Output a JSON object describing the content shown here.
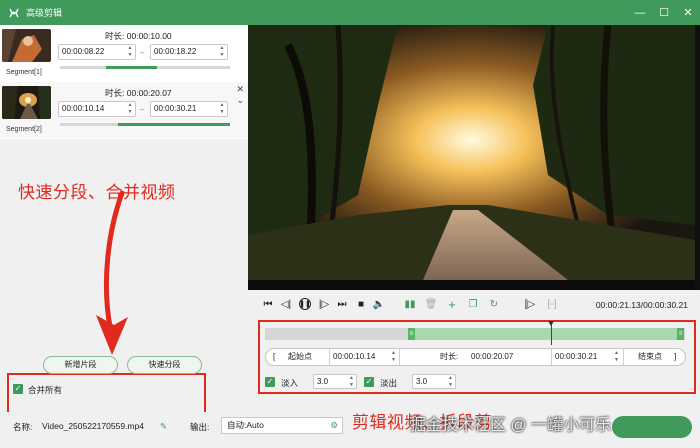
{
  "window": {
    "title": "高级剪辑",
    "controls": {
      "minimize": "—",
      "maximize": "☐",
      "close": "✕"
    }
  },
  "segments": [
    {
      "label": "Segment[1]",
      "duration_label": "时长:",
      "duration": "00:00:10.00",
      "start": "00:00:08.22",
      "end": "00:00:18.22",
      "progress": 0.3,
      "progress_start": 0.27
    },
    {
      "label": "Segment[2]",
      "duration_label": "时长:",
      "duration": "00:00:20.07",
      "start": "00:00:10.14",
      "end": "00:00:30.21",
      "progress": 0.66,
      "progress_start": 0.34
    }
  ],
  "annotations": {
    "left": "快速分段、合并视频",
    "right": "剪辑视频、拆段剪"
  },
  "watermark": "掘金技术社区 @ 一罐小可乐",
  "left_panel": {
    "add_segment": "新增片段",
    "quick_split": "快速分段",
    "merge_all_label": "合并所有",
    "merge_all_checked": true
  },
  "player": {
    "timecode": "00:00:21.13/00:00:30.21"
  },
  "timeline": {
    "selection_start": 0.34,
    "selection_end": 1.0,
    "playhead": 0.7
  },
  "range": {
    "start_button": "起始点",
    "start": "00:00:10.14",
    "duration_label": "时长:",
    "duration": "00:00:20.07",
    "end": "00:00:30.21",
    "end_button": "结束点",
    "bracket_left": "[",
    "bracket_right": "]"
  },
  "fade": {
    "fade_in_label": "淡入",
    "fade_in": "3.0",
    "fade_out_label": "淡出",
    "fade_out": "3.0",
    "fade_in_checked": true,
    "fade_out_checked": true
  },
  "bottom": {
    "name_label": "名称:",
    "filename": "Video_250522170559.mp4",
    "output_label": "输出:",
    "output_value": "自动:Auto"
  },
  "colors": {
    "accent": "#3f9a5c",
    "annotation": "#e02a1d"
  }
}
